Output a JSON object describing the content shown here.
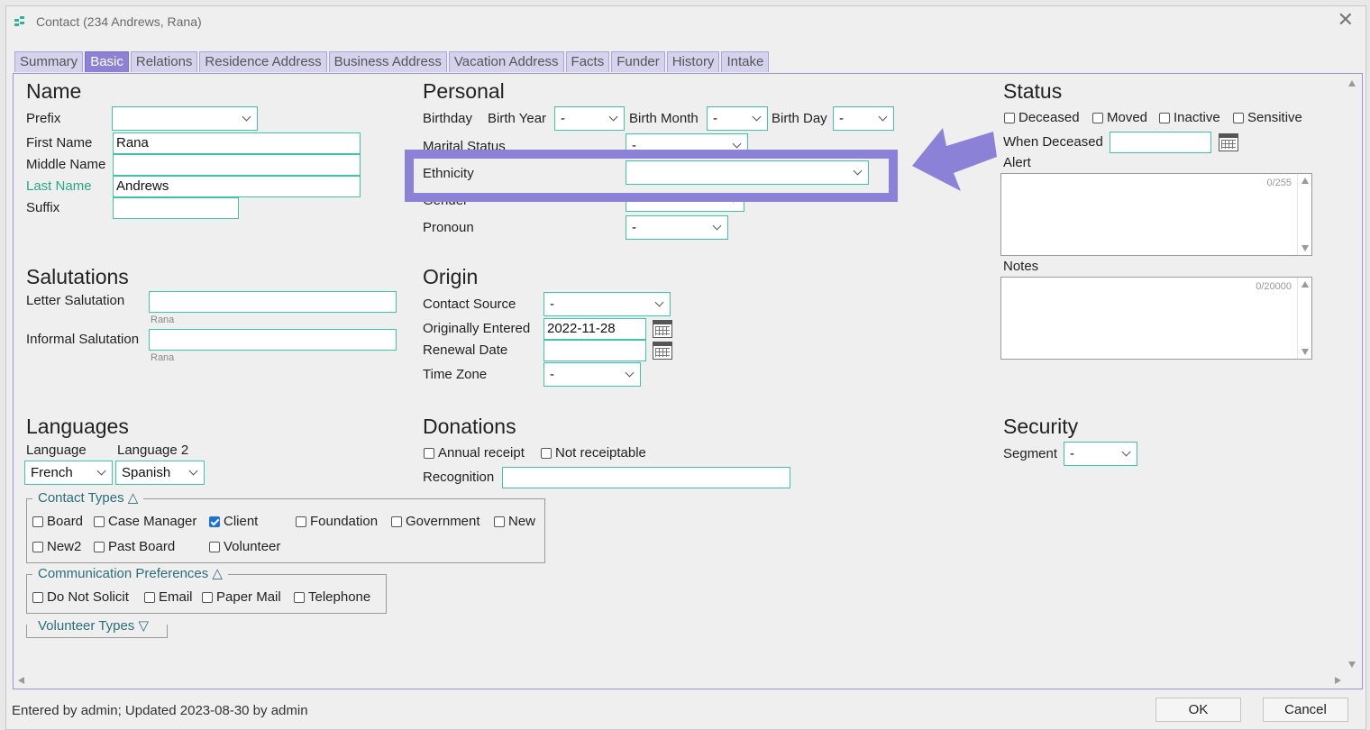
{
  "window": {
    "title": "Contact (234   Andrews, Rana)"
  },
  "tabs": [
    "Summary",
    "Basic",
    "Relations",
    "Residence Address",
    "Business Address",
    "Vacation Address",
    "Facts",
    "Funder",
    "History",
    "Intake"
  ],
  "active_tab": "Basic",
  "name": {
    "heading": "Name",
    "prefix_label": "Prefix",
    "prefix_value": "",
    "first_name_label": "First Name",
    "first_name_value": "Rana",
    "middle_name_label": "Middle Name",
    "middle_name_value": "",
    "last_name_label": "Last Name",
    "last_name_value": "Andrews",
    "suffix_label": "Suffix",
    "suffix_value": ""
  },
  "salutations": {
    "heading": "Salutations",
    "letter_label": "Letter Salutation",
    "letter_value": "",
    "letter_hint": "Rana",
    "informal_label": "Informal Salutation",
    "informal_value": "",
    "informal_hint": "Rana"
  },
  "languages": {
    "heading": "Languages",
    "language_label": "Language",
    "language_value": "French",
    "language2_label": "Language 2",
    "language2_value": "Spanish"
  },
  "contact_types": {
    "legend": "Contact Types △",
    "items": [
      {
        "label": "Board",
        "checked": false
      },
      {
        "label": "Case Manager",
        "checked": false
      },
      {
        "label": "Client",
        "checked": true
      },
      {
        "label": "Foundation",
        "checked": false
      },
      {
        "label": "Government",
        "checked": false
      },
      {
        "label": "New",
        "checked": false
      },
      {
        "label": "New2",
        "checked": false
      },
      {
        "label": "Past Board",
        "checked": false
      },
      {
        "label": "Volunteer",
        "checked": false
      }
    ]
  },
  "communication_preferences": {
    "legend": "Communication Preferences △",
    "items": [
      {
        "label": "Do Not Solicit",
        "checked": false
      },
      {
        "label": "Email",
        "checked": false
      },
      {
        "label": "Paper Mail",
        "checked": false
      },
      {
        "label": "Telephone",
        "checked": false
      }
    ]
  },
  "volunteer_types": {
    "legend": "Volunteer Types ▽"
  },
  "personal": {
    "heading": "Personal",
    "birthday_label": "Birthday",
    "birth_year_label": "Birth Year",
    "birth_year_value": "-",
    "birth_month_label": "Birth Month",
    "birth_month_value": "-",
    "birth_day_label": "Birth Day",
    "birth_day_value": "-",
    "marital_label": "Marital Status",
    "marital_value": "-",
    "ethnicity_label": "Ethnicity",
    "ethnicity_value": "",
    "gender_label": "Gender",
    "gender_value": "",
    "pronoun_label": "Pronoun",
    "pronoun_value": "-"
  },
  "origin": {
    "heading": "Origin",
    "contact_source_label": "Contact Source",
    "contact_source_value": "-",
    "originally_entered_label": "Originally Entered",
    "originally_entered_value": "2022-11-28",
    "renewal_label": "Renewal Date",
    "renewal_value": "",
    "timezone_label": "Time Zone",
    "timezone_value": "-"
  },
  "donations": {
    "heading": "Donations",
    "annual_receipt": {
      "label": "Annual receipt",
      "checked": false
    },
    "not_receiptable": {
      "label": "Not receiptable",
      "checked": false
    },
    "recognition_label": "Recognition",
    "recognition_value": ""
  },
  "status": {
    "heading": "Status",
    "checks": [
      {
        "label": "Deceased",
        "checked": false
      },
      {
        "label": "Moved",
        "checked": false
      },
      {
        "label": "Inactive",
        "checked": false
      },
      {
        "label": "Sensitive",
        "checked": false
      }
    ],
    "when_deceased_label": "When Deceased",
    "when_deceased_value": "",
    "alert_label": "Alert",
    "alert_counter": "0/255",
    "notes_label": "Notes",
    "notes_counter": "0/20000"
  },
  "security": {
    "heading": "Security",
    "segment_label": "Segment",
    "segment_value": "-"
  },
  "footer": {
    "text": "Entered by admin; Updated 2023-08-30 by admin",
    "ok": "OK",
    "cancel": "Cancel"
  },
  "colors": {
    "accent": "#8b82d8",
    "field_border": "#41c3aa",
    "required_label": "#29a889"
  }
}
